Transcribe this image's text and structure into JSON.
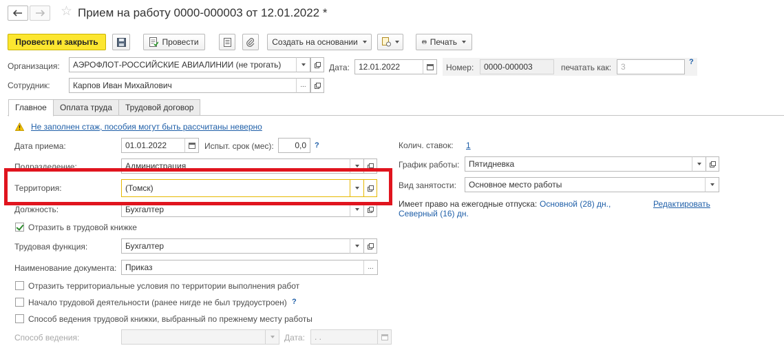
{
  "window": {
    "title": "Прием на работу 0000-000003 от 12.01.2022 *"
  },
  "toolbar": {
    "post_close": "Провести и закрыть",
    "post": "Провести",
    "create_based": "Создать на основании",
    "print": "Печать"
  },
  "header": {
    "org_label": "Организация:",
    "org_value": "АЭРОФЛОТ-РОССИЙСКИЕ АВИАЛИНИИ (не трогать)",
    "date_label": "Дата:",
    "date_value": "12.01.2022",
    "number_label": "Номер:",
    "number_value": "0000-000003",
    "print_as_label": "печатать как:",
    "print_as_value": "3",
    "help": "?",
    "employee_label": "Сотрудник:",
    "employee_value": "Карпов Иван Михайлович"
  },
  "tabs": [
    {
      "label": "Главное"
    },
    {
      "label": "Оплата труда"
    },
    {
      "label": "Трудовой договор"
    }
  ],
  "main": {
    "warning_text": "Не заполнен стаж, пособия могут быть рассчитаны неверно",
    "hire_date_label": "Дата приема:",
    "hire_date_value": "01.01.2022",
    "probation_label": "Испыт. срок (мес):",
    "probation_value": "0,0",
    "help": "?",
    "department_label": "Подразделение:",
    "department_value": "Администрация",
    "territory_label": "Территория:",
    "territory_value": "(Томск)",
    "position_label": "Должность:",
    "position_value": "Бухгалтер",
    "record_book_label": "Отразить в трудовой книжке",
    "labor_function_label": "Трудовая функция:",
    "labor_function_value": "Бухгалтер",
    "doc_name_label": "Наименование документа:",
    "doc_name_value": "Приказ",
    "check_territorial_label": "Отразить территориальные условия по территории выполнения работ",
    "check_first_job_label": "Начало трудовой деятельности (ранее нигде не был трудоустроен)",
    "check_book_method_label": "Способ ведения трудовой книжки, выбранный по прежнему месту работы",
    "method_label": "Способ ведения:",
    "method_date_label": "Дата:",
    "method_date_value": " .  .",
    "rates_label": "Колич. ставок:",
    "rates_value": "1",
    "schedule_label": "График работы:",
    "schedule_value": "Пятидневка",
    "employment_label": "Вид занятости:",
    "employment_value": "Основное место работы",
    "vacation_prefix": "Имеет право на ежегодные отпуска:",
    "vacation_line1": "Основной (28) дн.,",
    "vacation_line2": "Северный (16) дн.",
    "edit_link": "Редактировать"
  },
  "colors": {
    "highlight_box": "#e0141e",
    "primary_button": "#fce630",
    "link": "#1f5fa8"
  }
}
